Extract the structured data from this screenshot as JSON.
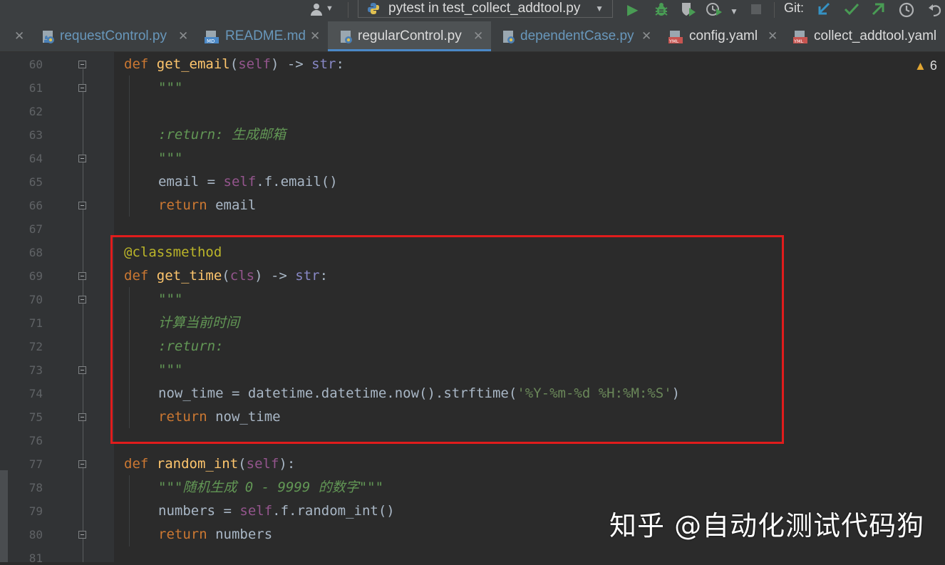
{
  "toolbar": {
    "run_config": "pytest in test_collect_addtool.py",
    "git_label": "Git:",
    "accent_run": "#499c54",
    "accent_git_update": "#3592c4",
    "accent_git_commit": "#499c54"
  },
  "tabs": [
    {
      "name": "requestControl.py",
      "icon": "python-file-icon",
      "color": "#6897bb"
    },
    {
      "name": "README.md",
      "icon": "markdown-file-icon",
      "color": "#6897bb"
    },
    {
      "name": "regularControl.py",
      "icon": "python-file-icon",
      "color": "#dcdcdc",
      "active": true
    },
    {
      "name": "dependentCase.py",
      "icon": "python-file-icon",
      "color": "#6897bb"
    },
    {
      "name": "config.yaml",
      "icon": "yaml-file-icon",
      "color": "#dcdcdc"
    },
    {
      "name": "collect_addtool.yaml",
      "icon": "yaml-file-icon",
      "color": "#dcdcdc"
    }
  ],
  "editor": {
    "line_numbers": [
      "60",
      "61",
      "62",
      "63",
      "64",
      "65",
      "66",
      "67",
      "68",
      "69",
      "70",
      "71",
      "72",
      "73",
      "74",
      "75",
      "76",
      "77",
      "78",
      "79",
      "80",
      "81"
    ],
    "warning_count": "6",
    "lines": {
      "l60": {
        "kw": "def",
        "fn": "get_email",
        "p1": "(",
        "self": "self",
        "p2": ") -> ",
        "ret": "str",
        "p3": ":"
      },
      "l61": {
        "doc": "\"\"\""
      },
      "l63": {
        "doc": ":return: 生成邮箱"
      },
      "l64": {
        "doc": "\"\"\""
      },
      "l65": {
        "a": "email = ",
        "self": "self",
        "b": ".f.email()"
      },
      "l66": {
        "kw": "return",
        "b": " email"
      },
      "l68": {
        "deco": "@classmethod"
      },
      "l69": {
        "kw": "def",
        "fn": "get_time",
        "p1": "(",
        "self": "cls",
        "p2": ") -> ",
        "ret": "str",
        "p3": ":"
      },
      "l70": {
        "doc": "\"\"\""
      },
      "l71": {
        "doc": "计算当前时间"
      },
      "l72": {
        "doc": ":return:"
      },
      "l73": {
        "doc": "\"\"\""
      },
      "l74": {
        "a": "now_time = datetime.datetime.now().strftime(",
        "str": "'%Y-%m-%d %H:%M:%S'",
        "b": ")"
      },
      "l75": {
        "kw": "return",
        "b": " now_time"
      },
      "l77": {
        "kw": "def",
        "fn": "random_int",
        "p1": "(",
        "self": "self",
        "p2": "):"
      },
      "l78": {
        "doc": "\"\"\"随机生成 0 - 9999 的数字\"\"\""
      },
      "l79": {
        "a": "numbers = ",
        "self": "self",
        "b": ".f.random_int()"
      },
      "l80": {
        "kw": "return",
        "b": " numbers"
      }
    }
  },
  "highlight_color": "#e01c1c",
  "watermark": "知乎 @自动化测试代码狗"
}
